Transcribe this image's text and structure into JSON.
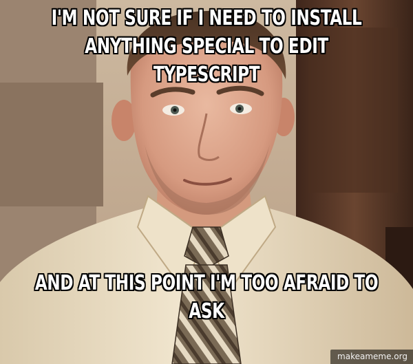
{
  "meme": {
    "top_text": "I'M NOT SURE IF I NEED TO INSTALL ANYTHING SPECIAL TO EDIT TYPESCRIPT",
    "bottom_text": "AND AT THIS POINT I'M TOO AFRAID TO ASK",
    "watermark": "makeameme.org"
  },
  "colors": {
    "caption_fill": "#ffffff",
    "caption_outline": "#000000",
    "shirt": "#e9dcc1",
    "background_wall": "#d8c7b0",
    "door": "#5a3a2a"
  }
}
